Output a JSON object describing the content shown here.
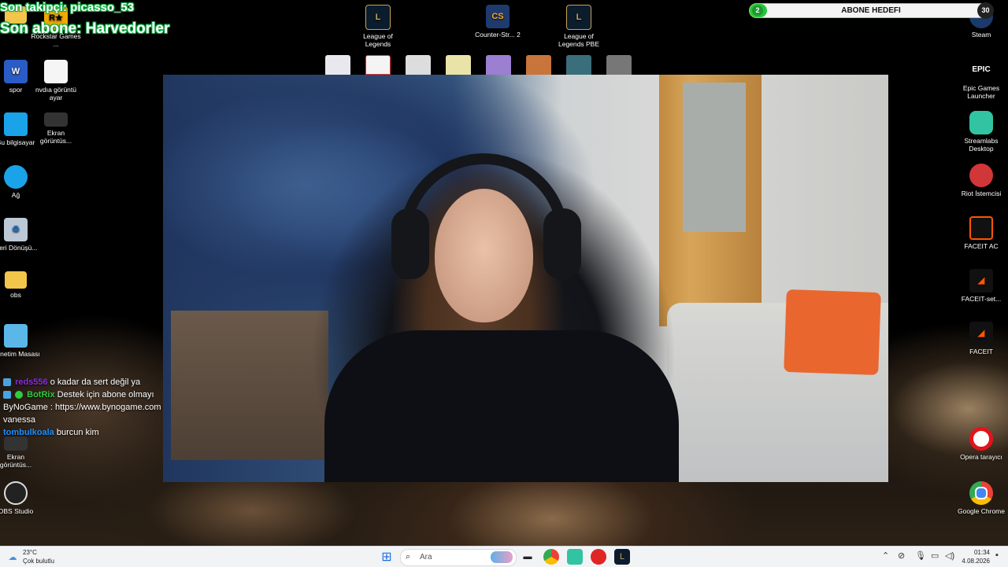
{
  "overlay": {
    "last_follower": "Son takipçi: picasso_53",
    "last_subscriber": "Son abone: Harvedorler"
  },
  "sub_goal": {
    "label": "ABONE HEDEFI",
    "current": "2",
    "target": "30",
    "progress": 0.07,
    "fill_color": "#27c43b"
  },
  "desktop_left": [
    {
      "label": "Belge su",
      "icon": "folder-icon"
    },
    {
      "label": "Rockstar Games ...",
      "icon": "rockstar-icon"
    },
    {
      "label": "spor",
      "icon": "word-icon"
    },
    {
      "label": "nvdıa görüntü ayar",
      "icon": "document-icon"
    },
    {
      "label": "Bu bilgisayar",
      "icon": "monitor-icon"
    },
    {
      "label": "Ekran görüntüs...",
      "icon": "screenshot-icon"
    },
    {
      "label": "Ağ",
      "icon": "network-icon"
    },
    {
      "label": "Geri Dönüşü...",
      "icon": "recycle-bin-icon"
    },
    {
      "label": "obs",
      "icon": "folder-icon"
    },
    {
      "label": "Denetim Masası",
      "icon": "control-panel-icon"
    },
    {
      "label": "Ekran görüntüs...",
      "icon": "screenshot-icon"
    },
    {
      "label": "OBS Studio",
      "icon": "obs-icon"
    }
  ],
  "desktop_top": [
    {
      "label": "League of Legends",
      "icon": "league-icon"
    },
    {
      "label": "Counter-Str... 2",
      "icon": "cs2-icon"
    },
    {
      "label": "League of Legends PBE",
      "icon": "league-icon"
    }
  ],
  "desktop_right": [
    {
      "label": "Steam",
      "icon": "steam-icon"
    },
    {
      "label": "Epic Games Launcher",
      "icon": "epic-icon",
      "glyph": "EPIC"
    },
    {
      "label": "Streamlabs Desktop",
      "icon": "streamlabs-icon"
    },
    {
      "label": "Riot İstemcisi",
      "icon": "riot-icon"
    },
    {
      "label": "FACEIT AC",
      "icon": "faceit-ac-icon"
    },
    {
      "label": "FACEIT-set...",
      "icon": "faceit-icon"
    },
    {
      "label": "FACEIT",
      "icon": "faceit-icon"
    },
    {
      "label": "Opera tarayıcı",
      "icon": "opera-icon"
    },
    {
      "label": "Google Chrome",
      "icon": "chrome-icon"
    }
  ],
  "chat": [
    {
      "user": "reds556",
      "text": "o kadar da sert değil ya",
      "color": "#8a2be2"
    },
    {
      "user": "BotRix",
      "text": "Destek için abone olmayı",
      "color": "#2ecc40"
    },
    {
      "user": "",
      "text": "ByNoGame : https://www.bynogame.com",
      "color": ""
    },
    {
      "user": "",
      "text": "vanessa",
      "color": ""
    },
    {
      "user": "tombulkoala",
      "text": "burcun kim",
      "color": "#1e90ff"
    }
  ],
  "taskbar": {
    "weather_temp": "23°C",
    "weather_text": "Çok bulutlu",
    "search_placeholder": "Ara",
    "time": "01:34",
    "date": "4.08.2026"
  },
  "colors": {
    "overlay_green": "#1a4",
    "taskbar_bg": "#f1f3f5"
  }
}
